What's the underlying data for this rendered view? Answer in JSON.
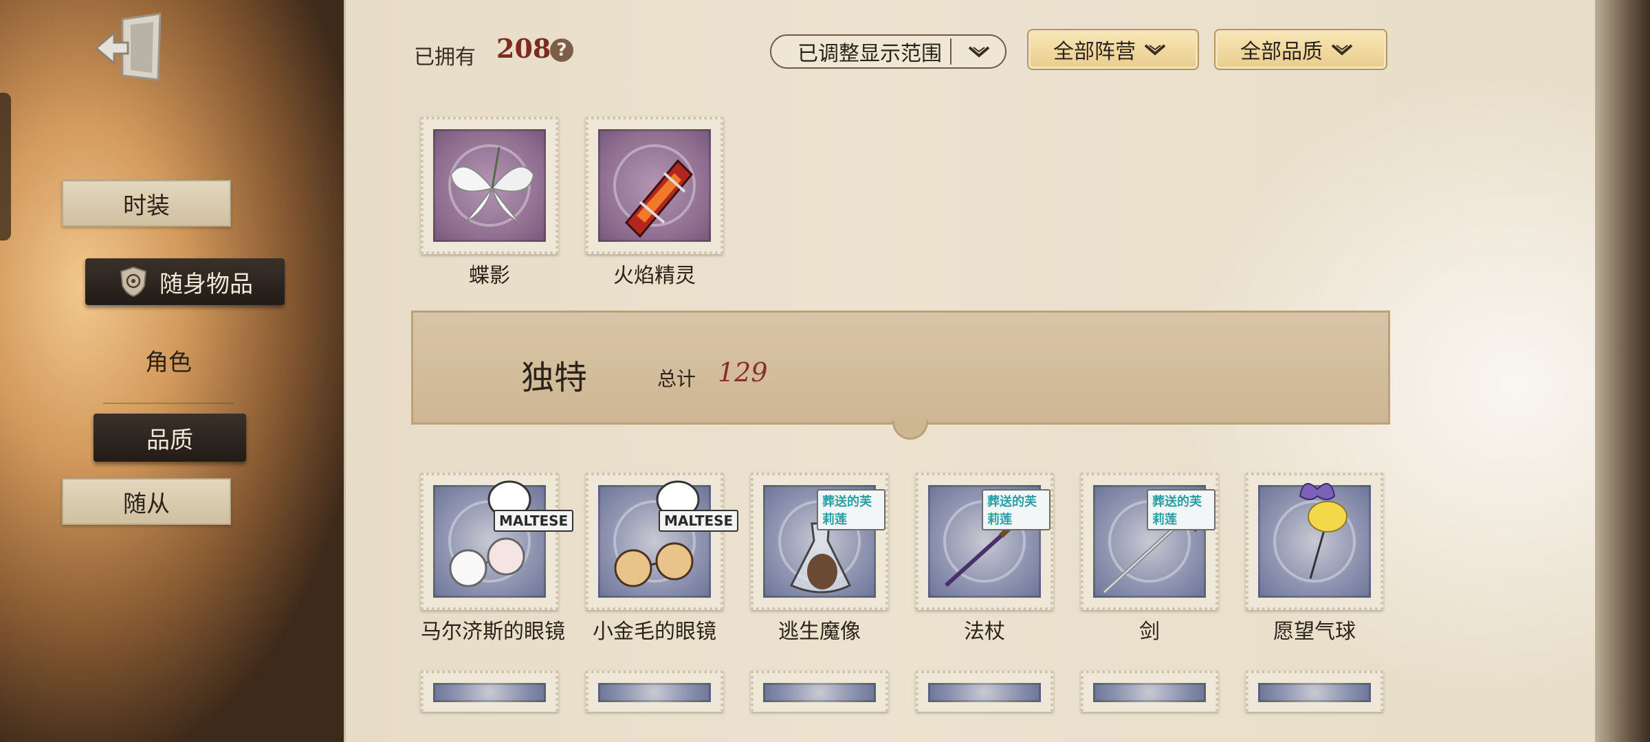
{
  "sidebar": {
    "items": [
      {
        "label": "时装",
        "state": "normal"
      },
      {
        "label": "随身物品",
        "state": "selected"
      },
      {
        "label": "角色",
        "state": "plain"
      },
      {
        "label": "品质",
        "state": "selected-dark"
      },
      {
        "label": "随从",
        "state": "normal"
      }
    ]
  },
  "header": {
    "owned_label": "已拥有",
    "owned_count": "208",
    "help": "?",
    "filters": {
      "range": "已调整显示范围",
      "faction": "全部阵营",
      "quality": "全部品质"
    }
  },
  "partial_items": [
    {
      "label": "蝶影",
      "icon": "butterfly-flower-icon"
    },
    {
      "label": "火焰精灵",
      "icon": "flame-crystal-icon"
    }
  ],
  "section": {
    "title": "独特",
    "total_label": "总计",
    "total": "129"
  },
  "unique_items": [
    {
      "label": "马尔济斯的眼镜",
      "tag": "MALTESE",
      "icon": "glasses-icon"
    },
    {
      "label": "小金毛的眼镜",
      "tag": "MALTESE",
      "icon": "glasses-icon"
    },
    {
      "label": "逃生魔像",
      "tag": "葬送的芙莉莲",
      "icon": "bottle-icon"
    },
    {
      "label": "法杖",
      "tag": "葬送的芙莉莲",
      "icon": "staff-icon"
    },
    {
      "label": "剑",
      "tag": "葬送的芙莉莲",
      "icon": "sword-icon"
    },
    {
      "label": "愿望气球",
      "tag": "",
      "icon": "balloon-icon"
    }
  ],
  "colors": {
    "accent_red": "#7c2b20",
    "stamp_purple": "#8f6e90",
    "stamp_blue": "#6f779a",
    "teal_tag": "#2a9fa3"
  }
}
